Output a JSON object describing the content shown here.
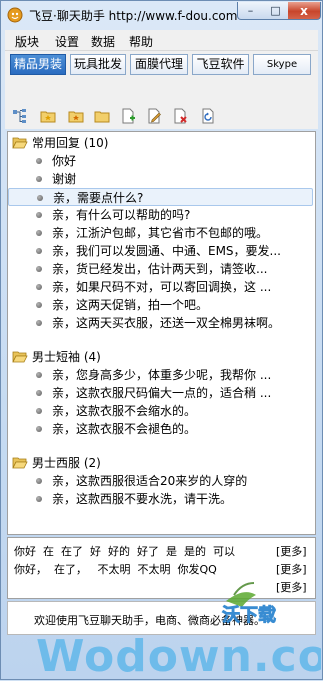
{
  "window": {
    "title": "飞豆·聊天助手 http://www.f-dou.com",
    "minimize_glyph": "–",
    "maximize_glyph": "□",
    "close_glyph": "x"
  },
  "menu": [
    "版块",
    "设置",
    "数据",
    "帮助"
  ],
  "tabs": [
    "精品男装",
    "玩具批发",
    "面膜代理",
    "飞豆软件",
    "Skype"
  ],
  "toolbar_icons": [
    "tree-view-icon",
    "new-folder-star-icon",
    "folder-star-icon",
    "folder-icon",
    "add-doc-icon",
    "edit-doc-icon",
    "delete-doc-icon",
    "refresh-doc-icon"
  ],
  "groups": [
    {
      "label": "常用回复 (10)",
      "items": [
        "你好",
        "谢谢",
        "亲，需要点什么?",
        "亲，有什么可以帮助的吗?",
        "亲，江浙沪包邮，其它省市不包邮的哦。",
        "亲，我们可以发圆通、中通、EMS，要发...",
        "亲，货已经发出，估计两天到，请签收...",
        "亲，如果尺码不对，可以寄回调换，这 ...",
        "亲，这两天促销，拍一个吧。",
        "亲，这两天买衣服，还送一双全棉男袜啊。"
      ]
    },
    {
      "label": "男士短袖 (4)",
      "items": [
        "亲，您身高多少，体重多少呢，我帮你 ...",
        "亲，这款衣服尺码偏大一点的，适合稍 ...",
        "亲，这款衣服不会缩水的。",
        "亲，这款衣服不会褪色的。"
      ]
    },
    {
      "label": "男士西服 (2)",
      "items": [
        "亲，这款西服很适合20来岁的人穿的",
        "亲，这款西服不要水洗，请干洗。"
      ]
    }
  ],
  "selected_item": "亲，需要点什么?",
  "quick_words": {
    "line1": "你好  在  在了  好  好的  好了  是  是的  可以",
    "line2": "你好，  在了，   不太明  不太明  你发QQ",
    "more_label": "[更多]"
  },
  "status": "欢迎使用飞豆聊天助手，电商、微商必备神器。",
  "watermark": {
    "main": "Wodown.com",
    "sub": "沃下载"
  }
}
